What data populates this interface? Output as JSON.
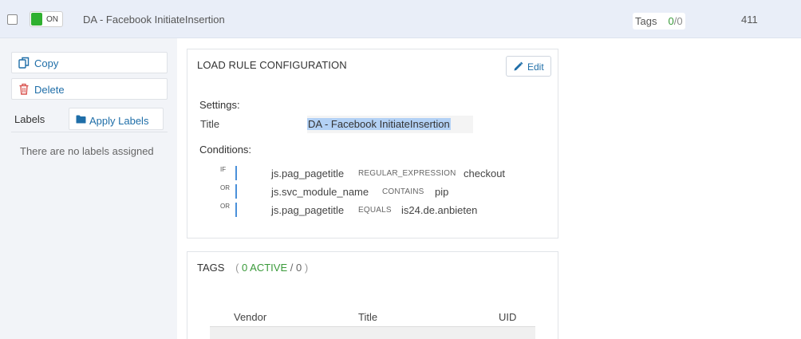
{
  "header": {
    "toggle_label": "ON",
    "title": "DA - Facebook InitiateInsertion",
    "tags_label": "Tags",
    "tags_active": "0",
    "tags_sep": "/",
    "tags_total": "0",
    "uid": "411"
  },
  "sidebar": {
    "copy_label": "Copy",
    "delete_label": "Delete",
    "labels_title": "Labels",
    "apply_labels_label": "Apply Labels",
    "no_labels_text": "There are no labels assigned"
  },
  "load_rule": {
    "heading": "LOAD RULE CONFIGURATION",
    "edit_label": "Edit",
    "settings_heading": "Settings:",
    "title_label": "Title",
    "title_value": "DA - Facebook InitiateInsertion",
    "conditions_heading": "Conditions:",
    "conditions": [
      {
        "op": "IF",
        "variable": "js.pag_pagetitle",
        "type": "REGULAR_EXPRESSION",
        "value": "checkout"
      },
      {
        "op": "OR",
        "variable": "js.svc_module_name",
        "type": "CONTAINS",
        "value": "pip"
      },
      {
        "op": "OR",
        "variable": "js.pag_pagetitle",
        "type": "EQUALS",
        "value": "is24.de.anbieten"
      }
    ]
  },
  "tags_panel": {
    "heading": "TAGS",
    "paren_open": "(",
    "active": "0 ACTIVE",
    "sep": "/",
    "total": "0",
    "paren_close": ")",
    "columns": [
      "Vendor",
      "Title",
      "UID"
    ]
  },
  "colors": {
    "accent_blue": "#1f6ea8",
    "toggle_on": "#2fb02f",
    "active_green": "#3a9a3a",
    "header_bg": "#e9eef8",
    "selection": "#b3d1f5"
  },
  "icons": {
    "copy": "copy-icon",
    "delete": "trash-icon",
    "apply_labels": "folder-icon",
    "edit": "pencil-icon"
  }
}
